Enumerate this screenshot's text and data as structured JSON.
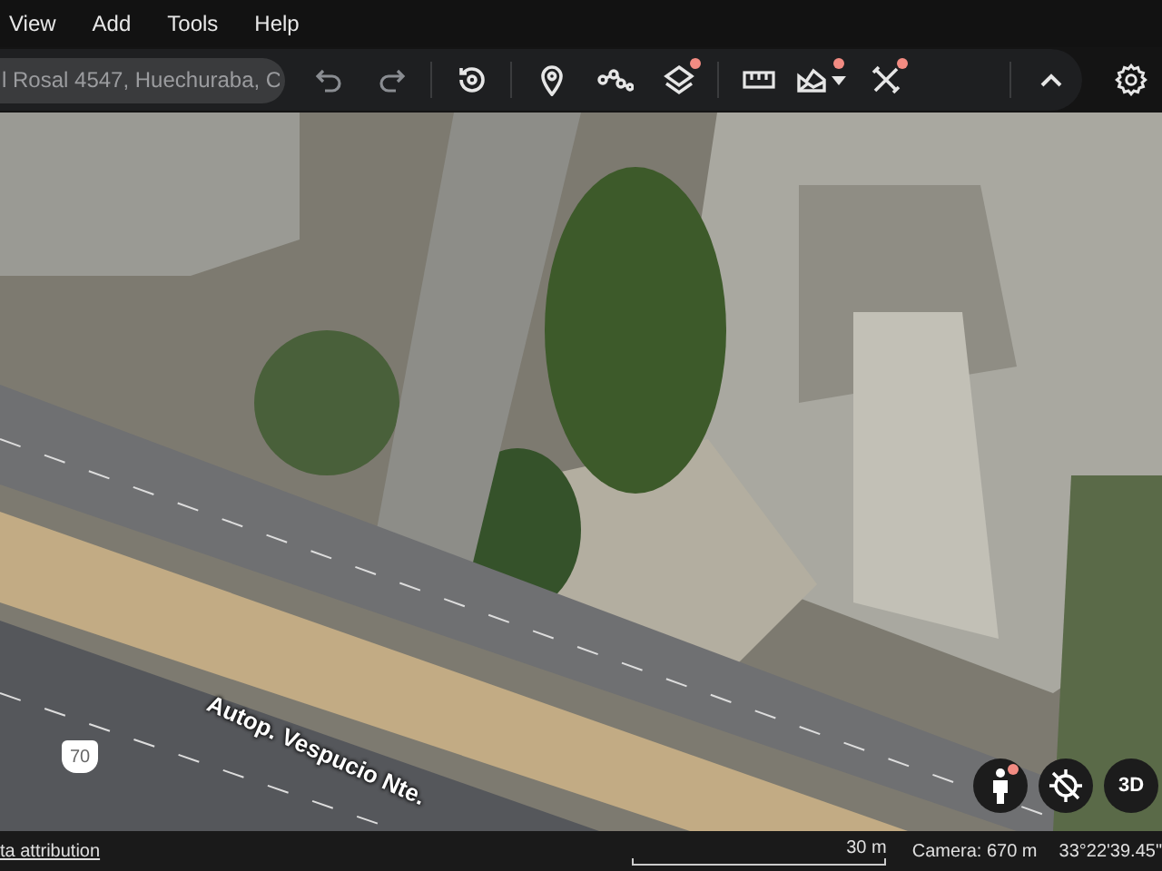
{
  "menu": [
    {
      "label": "View"
    },
    {
      "label": "Add"
    },
    {
      "label": "Tools"
    },
    {
      "label": "Help"
    }
  ],
  "search": {
    "value": "l Rosal 4547, Huechuraba, C"
  },
  "toolbar_groups": [
    [
      {
        "kind": "undo",
        "badge": false
      },
      {
        "kind": "redo",
        "badge": false
      }
    ],
    [
      {
        "kind": "history",
        "badge": false
      }
    ],
    [
      {
        "kind": "pin",
        "badge": false
      },
      {
        "kind": "path",
        "badge": false
      },
      {
        "kind": "layers",
        "badge": true
      }
    ],
    [
      {
        "kind": "ruler",
        "badge": false
      },
      {
        "kind": "terrain",
        "badge": true
      },
      {
        "kind": "tools",
        "badge": true
      }
    ],
    [
      {
        "kind": "collapse",
        "badge": false
      }
    ]
  ],
  "map": {
    "road_label": "Autop. Vespucio Nte.",
    "route_shield": "70"
  },
  "controls": [
    {
      "kind": "person",
      "badge": true
    },
    {
      "kind": "compass",
      "badge": false
    },
    {
      "kind": "text",
      "label": "3D",
      "badge": false
    }
  ],
  "status_bar": {
    "attribution": "ta attribution",
    "scale": "30 m",
    "camera": "Camera: 670 m",
    "coordinates": "33°22'39.45\""
  }
}
